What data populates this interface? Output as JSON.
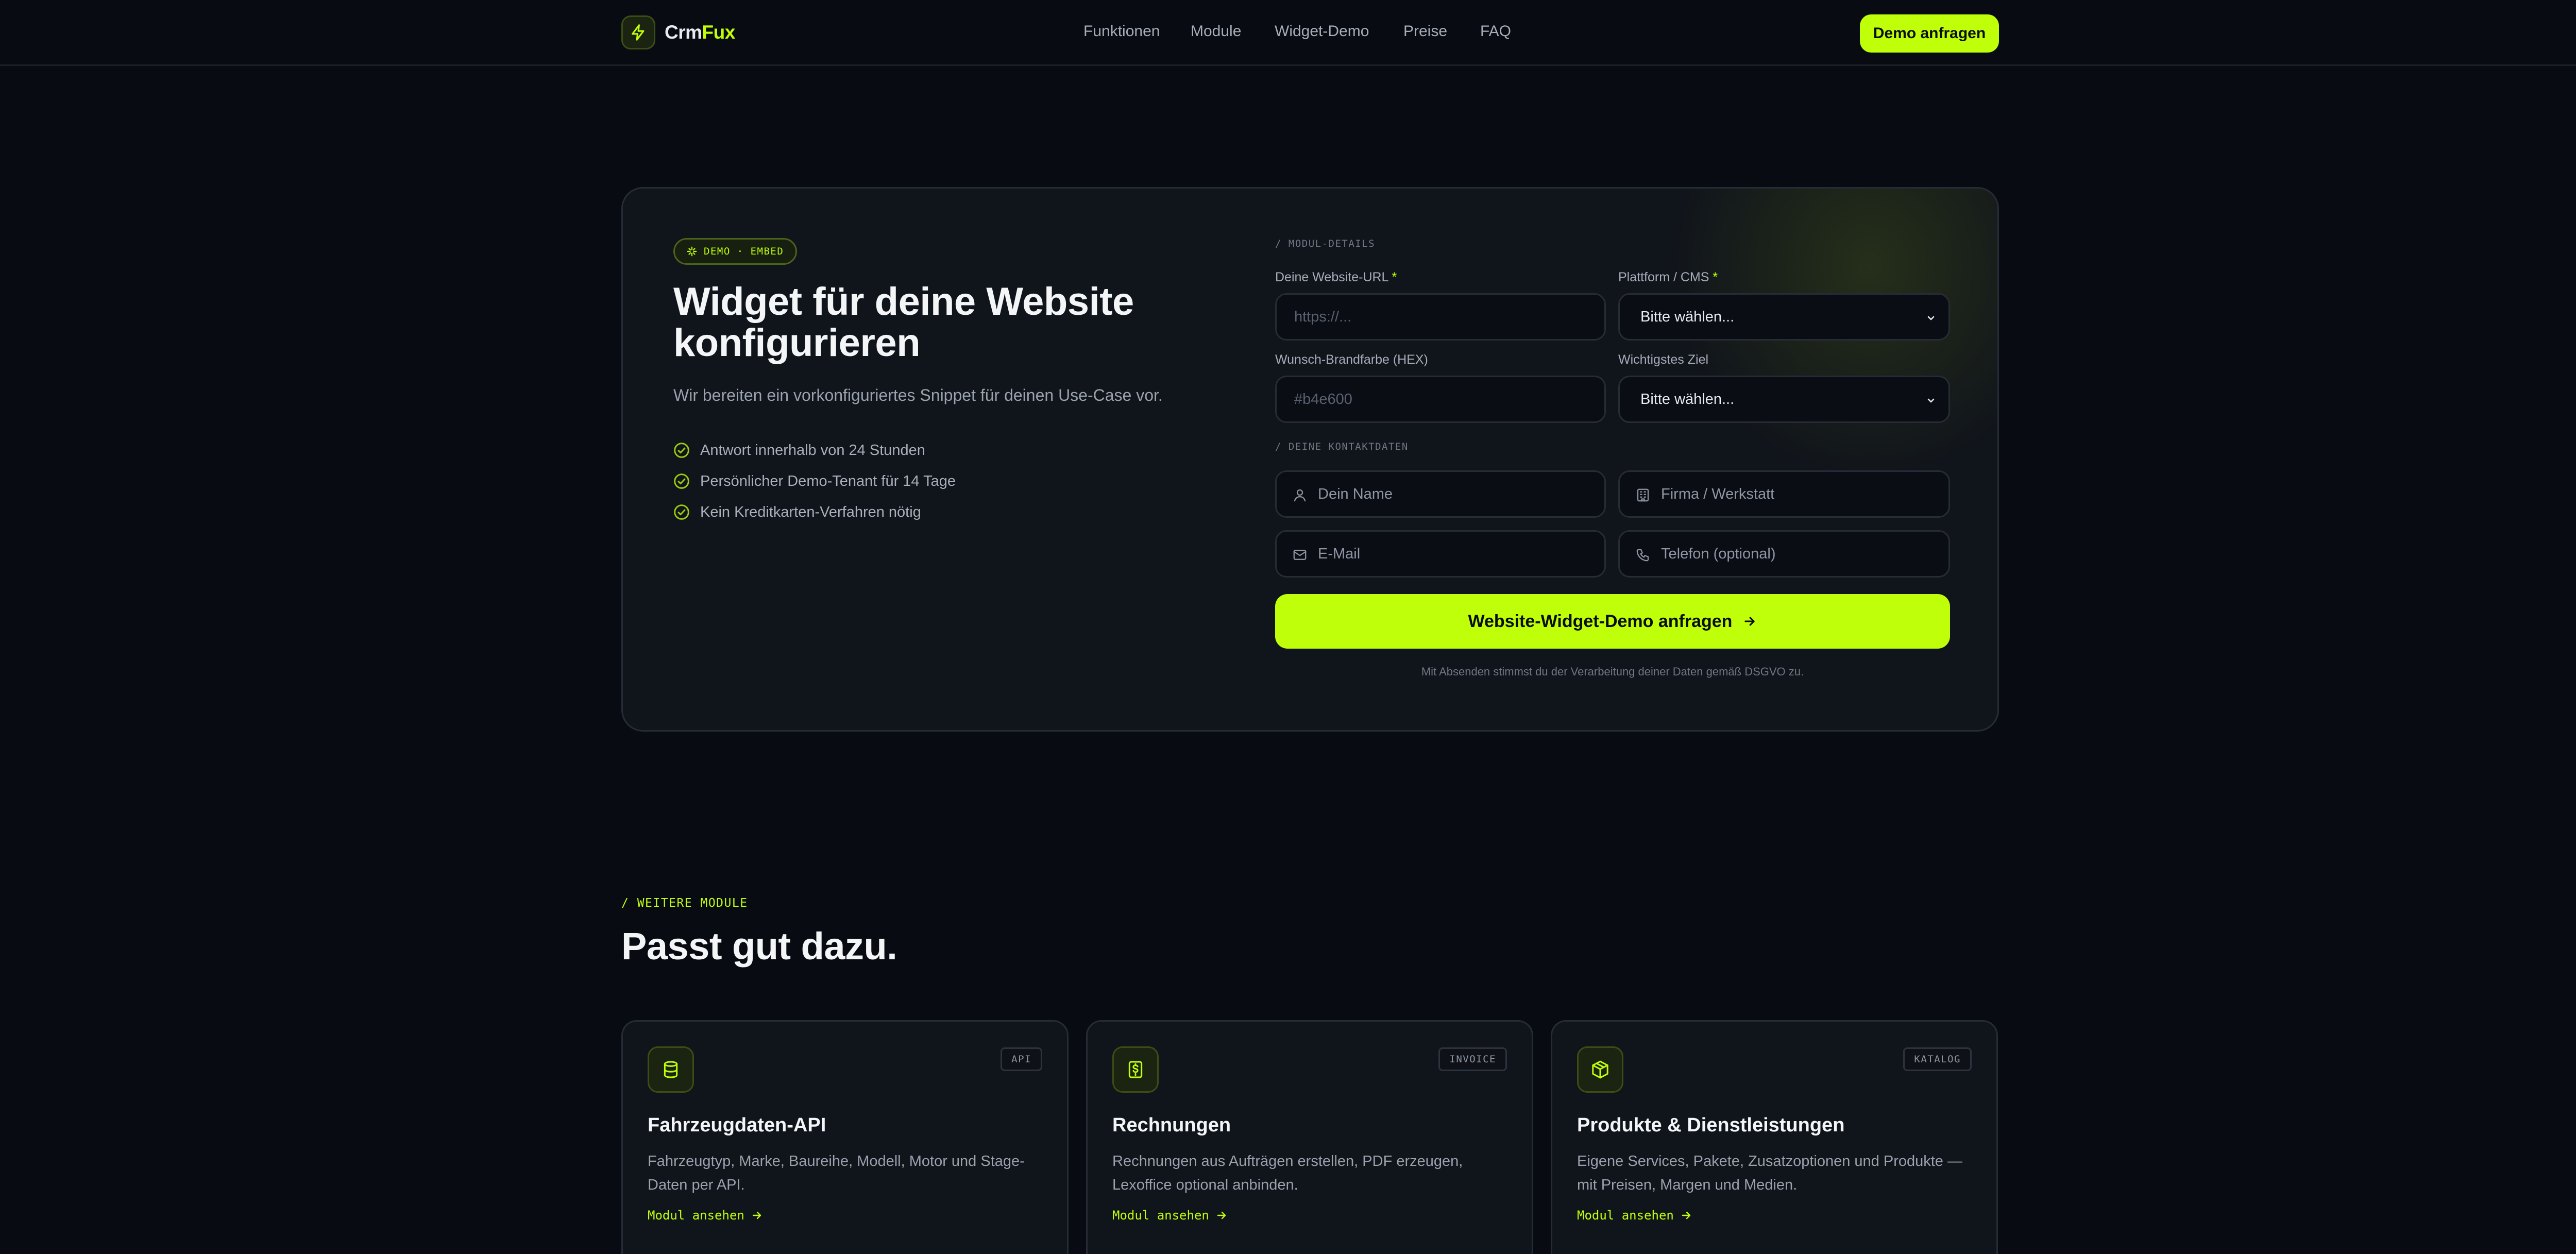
{
  "brand": {
    "name_part1": "Crm",
    "name_part2": "Fux",
    "accent": "#c0ff0a"
  },
  "nav": {
    "links": [
      "Funktionen",
      "Module",
      "Widget-Demo",
      "Preise",
      "FAQ"
    ],
    "cta": "Demo anfragen"
  },
  "hero": {
    "pill": "DEMO · EMBED",
    "title": "Widget für deine Website konfigurieren",
    "subtitle": "Wir bereiten ein vorkonfiguriertes Snippet für deinen Use-Case vor.",
    "checks": [
      "Antwort innerhalb von 24 Stunden",
      "Persönlicher Demo-Tenant für 14 Tage",
      "Kein Kreditkarten-Verfahren nötig"
    ]
  },
  "form": {
    "module_section": "/ MODUL-DETAILS",
    "url_label": "Deine Website-URL",
    "url_placeholder": "https://...",
    "platform_label": "Plattform / CMS",
    "platform_value": "Bitte wählen...",
    "color_label": "Wunsch-Brandfarbe (HEX)",
    "color_placeholder": "#b4e600",
    "goal_label": "Wichtigstes Ziel",
    "goal_value": "Bitte wählen...",
    "required_mark": "*",
    "contact_section": "/ DEINE KONTAKTDATEN",
    "name_placeholder": "Dein Name",
    "company_placeholder": "Firma / Werkstatt",
    "email_placeholder": "E-Mail",
    "phone_placeholder": "Telefon (optional)",
    "submit": "Website-Widget-Demo anfragen",
    "legal": "Mit Absenden stimmst du der Verarbeitung deiner Daten gemäß DSGVO zu."
  },
  "modules": {
    "label": "/ WEITERE MODULE",
    "title": "Passt gut dazu.",
    "items": [
      {
        "icon": "database-icon",
        "tag": "API",
        "name": "Fahrzeugdaten-API",
        "desc": "Fahrzeugtyp, Marke, Baureihe, Modell, Motor und Stage-Daten per API.",
        "link": "Modul ansehen"
      },
      {
        "icon": "invoice-icon",
        "tag": "INVOICE",
        "name": "Rechnungen",
        "desc": "Rechnungen aus Aufträgen erstellen, PDF erzeugen, Lexoffice optional anbinden.",
        "link": "Modul ansehen"
      },
      {
        "icon": "box-icon",
        "tag": "KATALOG",
        "name": "Produkte & Dienstleistungen",
        "desc": "Eigene Services, Pakete, Zusatzoptionen und Produkte — mit Preisen, Margen und Medien.",
        "link": "Modul ansehen"
      }
    ]
  }
}
